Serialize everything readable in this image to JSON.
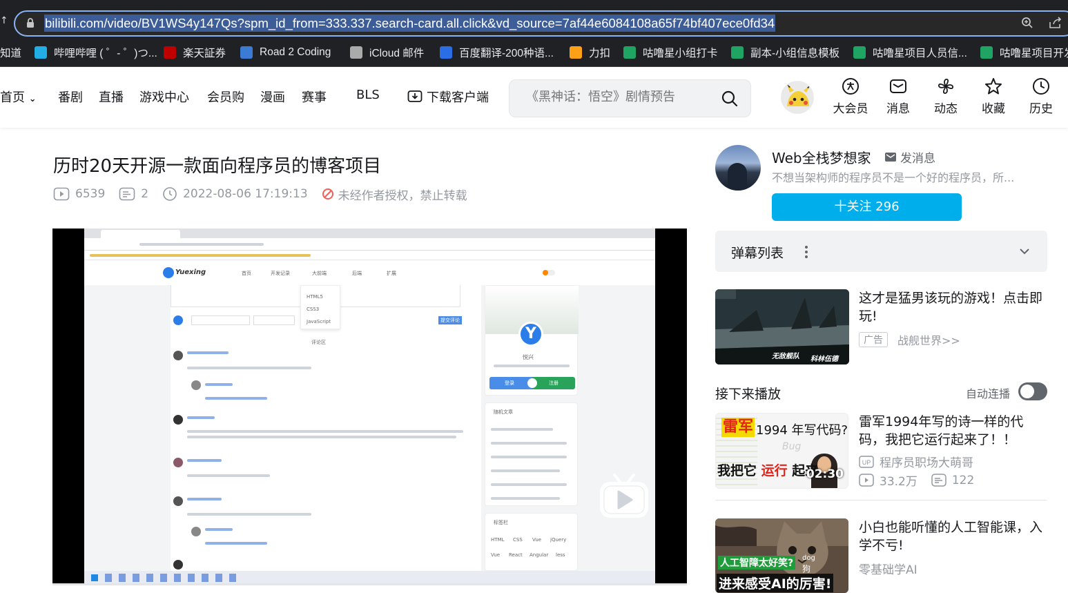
{
  "browser": {
    "url": "bilibili.com/video/BV1WS4y147Qs?spm_id_from=333.337.search-card.all.click&vd_source=7af44e6084108a65f74bf407ece0fd34",
    "bookmarks": [
      {
        "label": "知道",
        "color": "#555"
      },
      {
        "label": "哔哩哔哩 ( ゜- ゜)つ...",
        "color": "#23ade5"
      },
      {
        "label": "楽天証券",
        "color": "#bf0000"
      },
      {
        "label": "Road 2 Coding",
        "color": "#3b7bd4"
      },
      {
        "label": "iCloud 邮件",
        "color": "#aaa"
      },
      {
        "label": "百度翻译-200种语...",
        "color": "#2b6de5"
      },
      {
        "label": "力扣",
        "color": "#ffa116"
      },
      {
        "label": "咕噜星小组打卡",
        "color": "#1fa463"
      },
      {
        "label": "副本-小组信息模板",
        "color": "#1fa463"
      },
      {
        "label": "咕噜星项目人员信...",
        "color": "#1fa463"
      },
      {
        "label": "咕噜星项目开发",
        "color": "#1fa463"
      }
    ]
  },
  "header": {
    "nav": [
      "首页",
      "番剧",
      "直播",
      "游戏中心",
      "会员购",
      "漫画",
      "赛事",
      "BLS",
      "下载客户端"
    ],
    "search_placeholder": "《黑神话：悟空》剧情预告",
    "icons": [
      {
        "label": "大会员",
        "icon": "vip-icon"
      },
      {
        "label": "消息",
        "icon": "message-icon"
      },
      {
        "label": "动态",
        "icon": "dynamic-icon"
      },
      {
        "label": "收藏",
        "icon": "star-icon"
      },
      {
        "label": "历史",
        "icon": "history-icon"
      }
    ]
  },
  "video": {
    "title": "历时20天开源一款面向程序员的博客项目",
    "views": "6539",
    "danmaku_count": "2",
    "datetime": "2022-08-06 17:19:13",
    "copyright": "未经作者授权，禁止转载"
  },
  "player": {
    "inner_site_name": "Yuexing",
    "inner_menu": [
      "HTML5",
      "CSS3",
      "JavaScript"
    ],
    "inner_nav": [
      "首页",
      "开发记录",
      "大前端",
      "后端",
      "扩展"
    ],
    "inner_profile_name": "悦兴",
    "inner_btn_login": "登录",
    "inner_btn_register": "注册",
    "inner_section_articles": "随机文章",
    "inner_section_tags": "标签栏",
    "inner_tags": [
      "HTML",
      "CSS",
      "Vue",
      "jQuery",
      "Vue",
      "React",
      "Angular",
      "less"
    ],
    "inner_comment_label": "评论区",
    "inner_comment_submit": "提交评论",
    "progress": 0.0
  },
  "sidebar": {
    "up_name": "Web全栈梦想家",
    "send_message": "发消息",
    "up_desc": "不想当架构师的程序员不是一个好的程序员，所...",
    "follow": "十关注 296",
    "danmaku_list": "弹幕列表",
    "ad": {
      "title": "这才是猛男该玩的游戏！点击即玩!",
      "badge": "广告",
      "source": "战舰世界>>",
      "thumb_text_left": "无敌舰队",
      "thumb_text_right": "科林伍德"
    },
    "next_up": "接下来播放",
    "autoplay": "自动连播",
    "autoplay_on": false,
    "recommendations": [
      {
        "title": "雷军1994年写的诗一样的代码，我把它运行起来了！！",
        "up": "程序员职场大萌哥",
        "views": "33.2万",
        "danmaku": "122",
        "duration": "02:30",
        "thumb_line1_red": "雷军",
        "thumb_line1_black": "1994 年写代码?",
        "thumb_bug": "Bug",
        "thumb_line2_black": "我把它",
        "thumb_line2_red": "运行",
        "thumb_line2_end": "起来"
      },
      {
        "title": "小白也能听懂的人工智能课，入学不亏!",
        "up": "零基础学AI",
        "thumb_line1": "人工智障太好笑?",
        "thumb_line2": "进来感受AI的厉害!",
        "thumb_dog_en": "dog",
        "thumb_dog_cn": "狗"
      }
    ]
  }
}
